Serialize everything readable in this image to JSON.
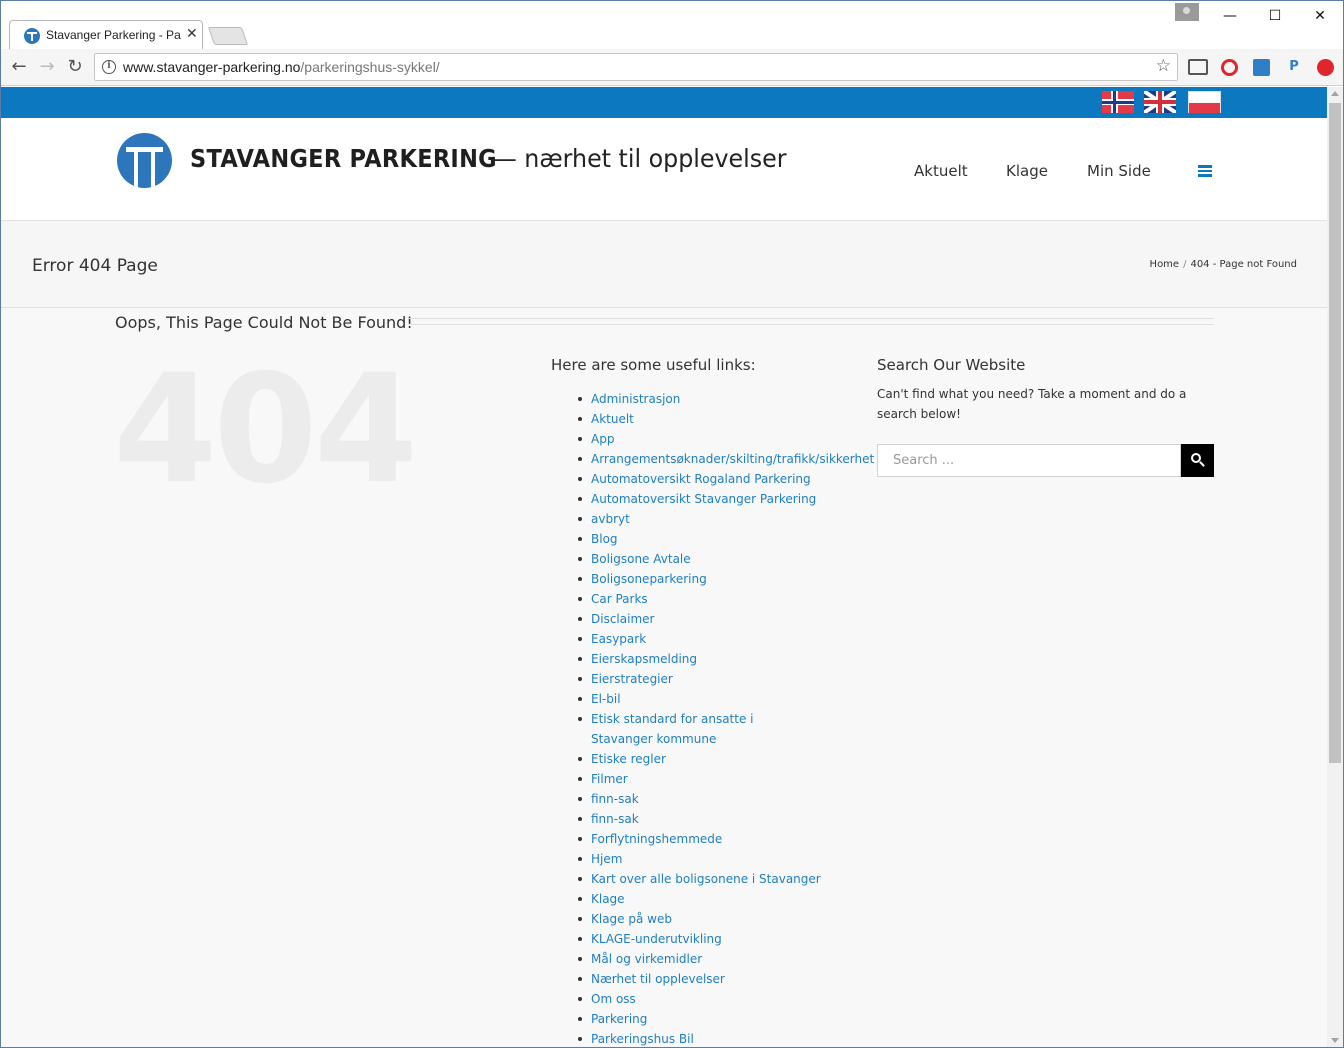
{
  "browser": {
    "tab_title": "Stavanger Parkering - Pa",
    "tab_close": "✕",
    "url_host": "www.stavanger-parkering.no",
    "url_path": "/parkeringshus-sykkel/",
    "win_minimize": "—",
    "win_maximize": "☐",
    "win_close": "✕",
    "back": "←",
    "forward": "→",
    "reload": "↻",
    "info": "i",
    "star": "☆"
  },
  "site": {
    "brand_name": "STAVANGER PARKERING",
    "tagline": "— nærhet til opplevelser",
    "nav": [
      "Aktuelt",
      "Klage",
      "Min Side"
    ],
    "flags": [
      "Norwegian",
      "English",
      "Polish"
    ]
  },
  "page": {
    "title": "Error 404 Page",
    "breadcrumb_home": "Home",
    "breadcrumb_sep": "/",
    "breadcrumb_current": "404 - Page not Found",
    "oops": "Oops, This Page Could Not Be Found!",
    "big_404": "404",
    "useful_heading": "Here are some useful links:",
    "links": [
      "Administrasjon",
      "Aktuelt",
      "App",
      "Arrangementsøknader/skilting/trafikk/sikkerhet",
      "Automatoversikt Rogaland Parkering",
      "Automatoversikt Stavanger Parkering",
      "avbryt",
      "Blog",
      "Boligsone Avtale",
      "Boligsoneparkering",
      "Car Parks",
      "Disclaimer",
      "Easypark",
      "Eierskapsmelding",
      "Eierstrategier",
      "El-bil",
      "Etisk standard for ansatte i Stavanger kommune",
      "Etiske regler",
      "Filmer",
      "finn-sak",
      "finn-sak",
      "Forflytningshemmede",
      "Hjem",
      "Kart over alle boligsonene i Stavanger",
      "Klage",
      "Klage på web",
      "KLAGE-underutvikling",
      "Mål og virkemidler",
      "Nærhet til opplevelser",
      "Om oss",
      "Parkering",
      "Parkeringshus Bil"
    ],
    "search_heading": "Search Our Website",
    "search_desc": "Can't find what you need? Take a moment and do a search below!",
    "search_placeholder": "Search ..."
  },
  "colors": {
    "brand_blue": "#0b78bf",
    "link_blue": "#1f7ec2",
    "logo_blue": "#2d76bb"
  }
}
